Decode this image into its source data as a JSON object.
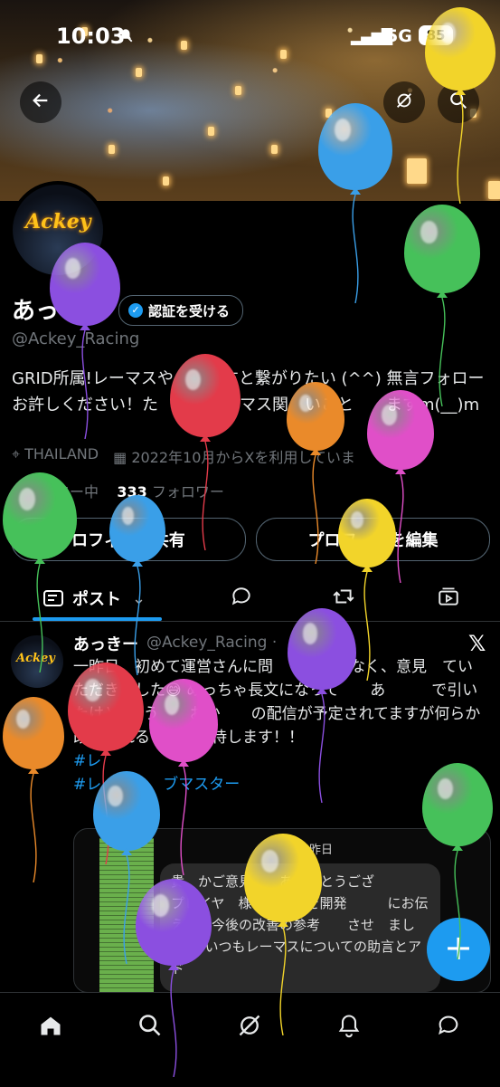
{
  "status": {
    "time": "10:03",
    "network": "5G",
    "battery": "85"
  },
  "header": {
    "back_icon": "arrow-left-icon",
    "grok_icon": "slash-circle-icon",
    "search_icon": "search-icon"
  },
  "profile": {
    "avatar_text": "Ackey",
    "name": "あっ",
    "verify_label": "認証を受ける",
    "handle": "@Ackey_Racing",
    "bio": "GRID所属!レーマスや　　　方と繋がりたい (^^) 無言フォローお許しください！た　　　レーマス関　いこと　　ますm(__)m",
    "location": "THAILAND",
    "joined": "2022年10月からXを利用していま",
    "following_label": "ロー中",
    "followers_count": "333",
    "followers_label": "フォロワー",
    "share_button": "ロフィ　を共有",
    "edit_button": "プロフ　　を編集"
  },
  "tabs": {
    "posts_label": "ポスト"
  },
  "post": {
    "avatar_text": "Ackey",
    "name": "あっきー",
    "handle": "@Ackey_Racing ·",
    "text": "一昨日、初めて運営さんに問　　せではなく、意見　てい　ただきました😅 めっちゃ長文になって　　あ　　　で引いたけど💦 う　　おか　　の配信が予定されてますが何らか改善されること　期待します！！",
    "hashtag1": "#レ",
    "hashtag2": "#レ　　　　ブマスター",
    "card_date": "昨日",
    "card_text": "貴　かご意見　　ありがとうござ　　　　プレイヤ　様のご意見を開発　　　にお伝えし、今後の改善の参考　　させ　ました。　いつもレーマスについての助言とアド"
  },
  "colors": {
    "accent": "#1d9bf0",
    "background": "#000000",
    "muted": "#71767b"
  },
  "balloons": [
    {
      "color": "#f2d42a",
      "name": "yellow"
    },
    {
      "color": "#3a9fe8",
      "name": "blue"
    },
    {
      "color": "#46c15a",
      "name": "green"
    },
    {
      "color": "#8b4fe0",
      "name": "purple"
    },
    {
      "color": "#e33b4a",
      "name": "red"
    },
    {
      "color": "#ea8a2a",
      "name": "orange"
    },
    {
      "color": "#e04fc8",
      "name": "pink"
    }
  ]
}
